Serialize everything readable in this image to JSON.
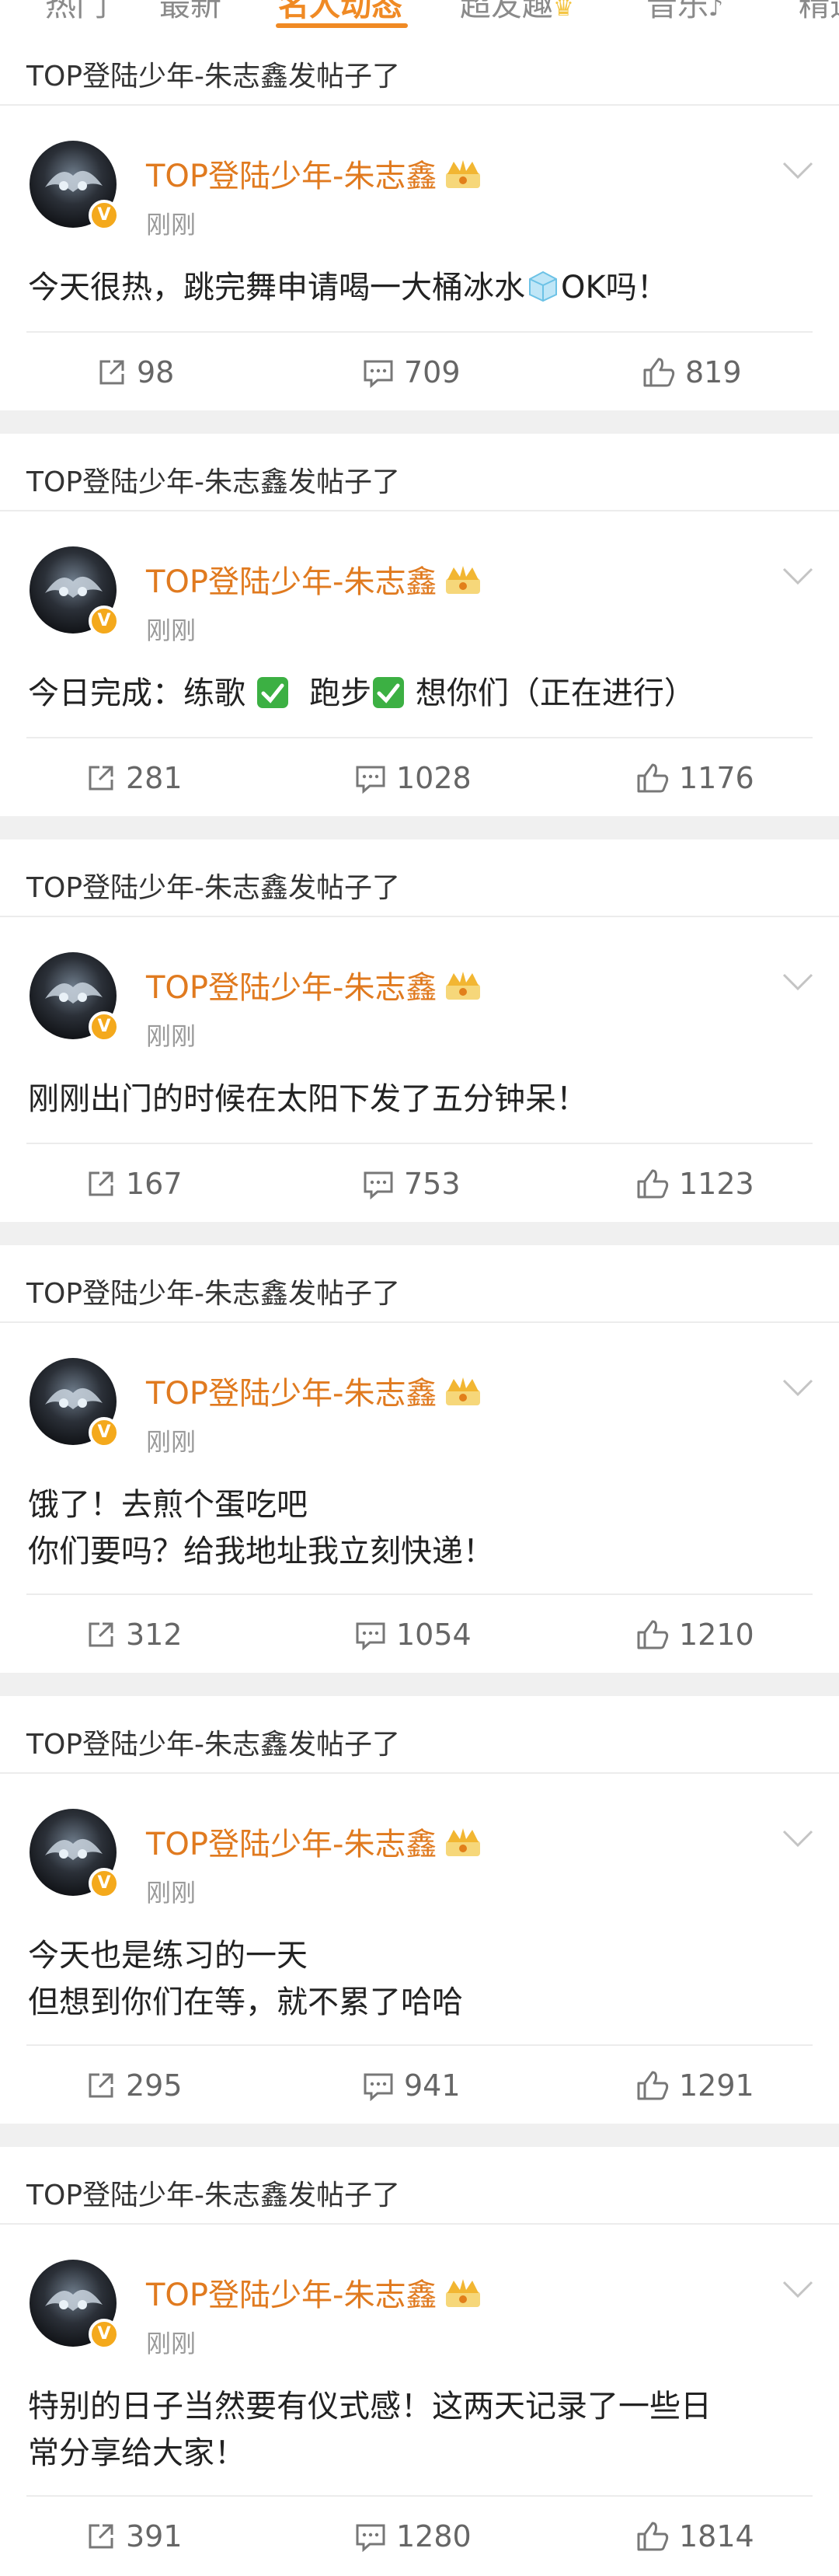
{
  "tabs": [
    {
      "label": "热门"
    },
    {
      "label": "最新"
    },
    {
      "label": "名人动态"
    },
    {
      "label": "超友趣"
    },
    {
      "label": "音乐"
    },
    {
      "label": "精选"
    }
  ],
  "posts": [
    {
      "group_header": "TOP登陆少年-朱志鑫发帖子了",
      "author": "TOP登陆少年-朱志鑫",
      "time": "刚刚",
      "line1": "今天很热，跳完舞申请喝一大桶冰水",
      "line1b": "OK吗！",
      "line2": "",
      "reposts": "98",
      "comments": "709",
      "likes": "819"
    },
    {
      "group_header": "TOP登陆少年-朱志鑫发帖子了",
      "author": "TOP登陆少年-朱志鑫",
      "time": "刚刚",
      "seg_a": "今日完成：练歌",
      "seg_b": "跑步",
      "seg_c": "想你们（正在进行）",
      "reposts": "281",
      "comments": "1028",
      "likes": "1176"
    },
    {
      "group_header": "TOP登陆少年-朱志鑫发帖子了",
      "author": "TOP登陆少年-朱志鑫",
      "time": "刚刚",
      "line1": "刚刚出门的时候在太阳下发了五分钟呆！",
      "line2": "",
      "reposts": "167",
      "comments": "753",
      "likes": "1123"
    },
    {
      "group_header": "TOP登陆少年-朱志鑫发帖子了",
      "author": "TOP登陆少年-朱志鑫",
      "time": "刚刚",
      "line1": "饿了！去煎个蛋吃吧",
      "line2": "你们要吗？给我地址我立刻快递！",
      "reposts": "312",
      "comments": "1054",
      "likes": "1210"
    },
    {
      "group_header": "TOP登陆少年-朱志鑫发帖子了",
      "author": "TOP登陆少年-朱志鑫",
      "time": "刚刚",
      "line1": "今天也是练习的一天",
      "line2": "但想到你们在等，就不累了哈哈",
      "reposts": "295",
      "comments": "941",
      "likes": "1291"
    },
    {
      "group_header": "TOP登陆少年-朱志鑫发帖子了",
      "author": "TOP登陆少年-朱志鑫",
      "time": "刚刚",
      "line1": "特别的日子当然要有仪式感！这两天记录了一些日",
      "line2": "常分享给大家！",
      "reposts": "391",
      "comments": "1280",
      "likes": "1814"
    }
  ],
  "colors": {
    "accent": "#f08a24",
    "username": "#e07a1f",
    "separator": "#f0f0f0",
    "check": "#3cb043"
  },
  "icons": {
    "repost": "repost-icon",
    "comment": "comment-icon",
    "like": "thumbs-up-icon",
    "more": "chevron-down-icon",
    "crown": "crown-badge-icon",
    "verified": "verified-v-icon",
    "ice": "ice-cube-emoji",
    "check": "check-mark-emoji"
  }
}
